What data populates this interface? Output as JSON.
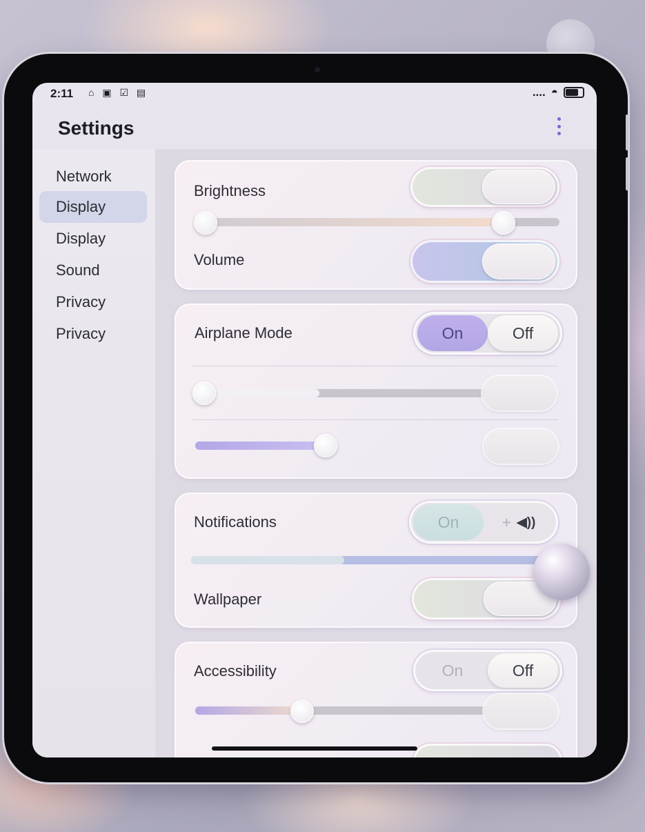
{
  "status_bar": {
    "time": "2:11",
    "left_icons": [
      "lock-icon",
      "doc-icon",
      "mail-icon",
      "notification-icon"
    ],
    "left_icons_text": "⌂ ▣ ☑ ▤",
    "signal": "....",
    "wifi_glyph": "◓",
    "right_icons": [
      "signal-dots-icon",
      "wifi-icon",
      "battery-icon"
    ]
  },
  "header": {
    "title": "Settings",
    "menu_icon": "kebab-menu-icon",
    "accent_color": "#7f63d6"
  },
  "sidebar": {
    "items": [
      {
        "label": "Network",
        "active": false
      },
      {
        "label": "Display",
        "active": true
      },
      {
        "label": "Display",
        "active": false
      },
      {
        "label": "Sound",
        "active": false
      },
      {
        "label": "Privacy",
        "active": false
      },
      {
        "label": "Privacy",
        "active": false
      }
    ]
  },
  "cards": {
    "display": {
      "brightness_label": "Brightness",
      "brightness_toggle": "on",
      "brightness_slider_value": 0.85,
      "volume_label": "Volume",
      "volume_toggle": "on"
    },
    "connectivity": {
      "airplane_label": "Airplane Mode",
      "airplane_on": "On",
      "airplane_off": "Off",
      "airplane_selected": "Off",
      "slider1_value": 0.42,
      "slider2_value": 0.45
    },
    "alerts": {
      "notifications_label": "Notifications",
      "notifications_on": "On",
      "notifications_plus": "+",
      "notifications_sound_glyph": "◀))",
      "notifications_slider_value": 0.45,
      "wallpaper_label": "Wallpaper",
      "wallpaper_toggle": "on"
    },
    "accessibility": {
      "accessibility_label": "Accessibility",
      "accessibility_on": "On",
      "accessibility_off": "Off",
      "accessibility_selected": "Off",
      "slider_value": 0.38
    }
  },
  "colors": {
    "active_sidebar": "#d3d5e9",
    "slider_fill_lavender": "#b3a7e6",
    "segment_active": "#b4a5e6"
  }
}
